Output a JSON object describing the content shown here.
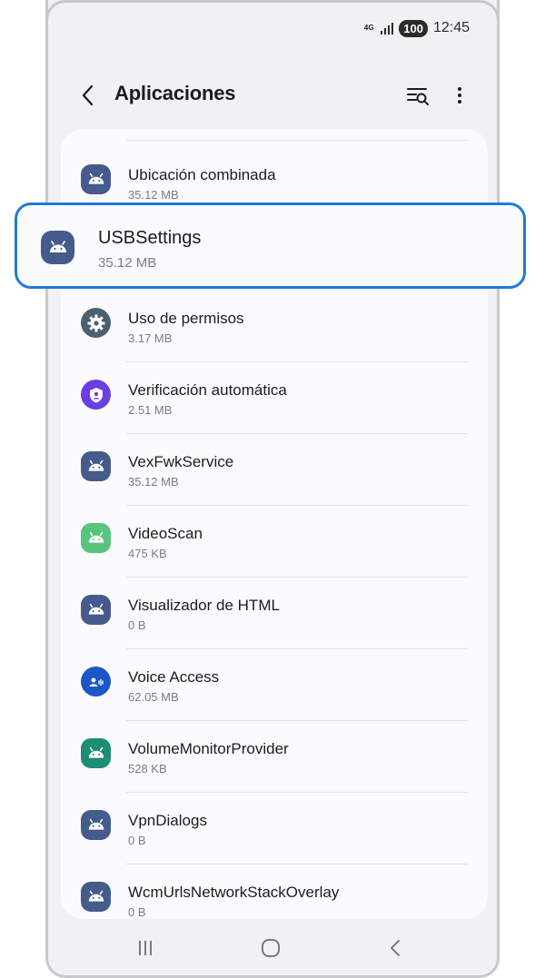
{
  "status_bar": {
    "network": "4G",
    "battery": "100",
    "time": "12:45"
  },
  "app_bar": {
    "title": "Aplicaciones"
  },
  "highlighted_app": {
    "name": "USBSettings",
    "size": "35.12 MB",
    "icon": "android-icon"
  },
  "apps": [
    {
      "name": "Ubicación combinada",
      "size": "35.12 MB",
      "icon": "android-icon"
    },
    {
      "name": "Uso de permisos",
      "size": "3.17 MB",
      "icon": "gear-icon"
    },
    {
      "name": "Verificación automática",
      "size": "2.51 MB",
      "icon": "shield-icon"
    },
    {
      "name": "VexFwkService",
      "size": "35.12 MB",
      "icon": "android-icon"
    },
    {
      "name": "VideoScan",
      "size": "475 KB",
      "icon": "android-green-icon"
    },
    {
      "name": "Visualizador de HTML",
      "size": "0 B",
      "icon": "android-icon"
    },
    {
      "name": "Voice Access",
      "size": "62.05 MB",
      "icon": "voice-access-icon"
    },
    {
      "name": "VolumeMonitorProvider",
      "size": "528 KB",
      "icon": "android-teal-icon"
    },
    {
      "name": "VpnDialogs",
      "size": "0 B",
      "icon": "android-icon"
    },
    {
      "name": "WcmUrlsNetworkStackOverlay",
      "size": "0 B",
      "icon": "android-icon"
    }
  ],
  "colors": {
    "highlight_border": "#1f7bd8",
    "android_icon": "#455b8c",
    "background": "#f1f1f4"
  }
}
